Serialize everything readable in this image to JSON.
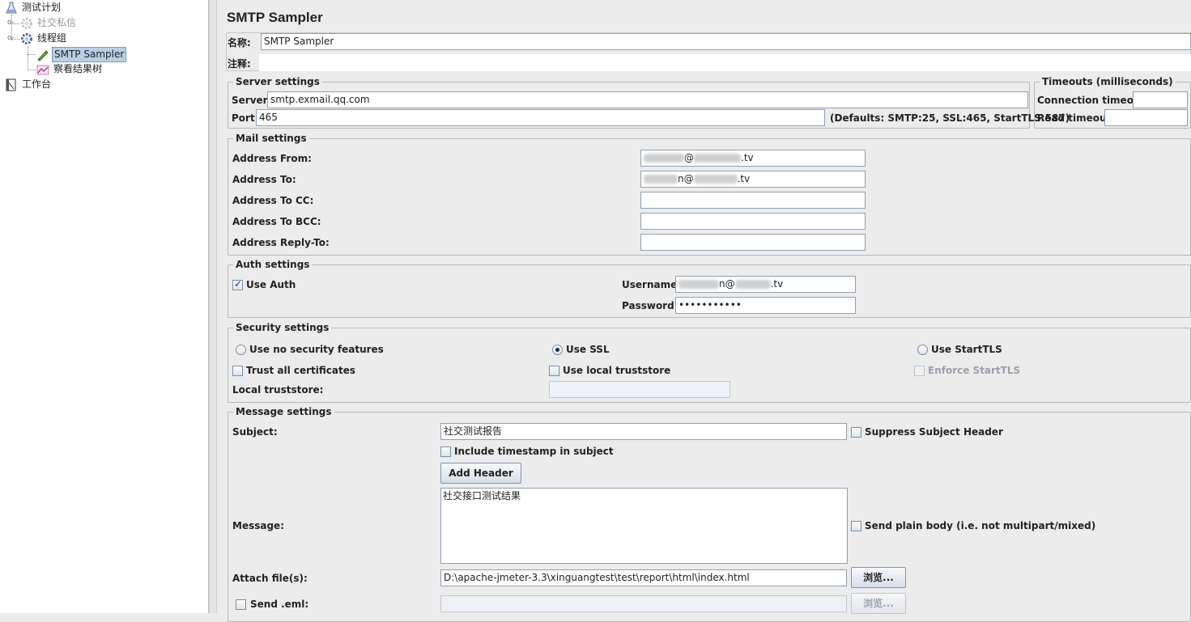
{
  "tree": {
    "items": [
      {
        "label": "测试计划",
        "icon": "test-plan-icon"
      },
      {
        "label": "社交私信",
        "icon": "thread-group-gear-icon",
        "disabled": true
      },
      {
        "label": "线程组",
        "icon": "thread-group-gear-icon"
      },
      {
        "label": "SMTP Sampler",
        "icon": "sampler-pen-icon",
        "selected": true
      },
      {
        "label": "察看结果树",
        "icon": "result-tree-icon"
      },
      {
        "label": "工作台",
        "icon": "workbench-icon"
      }
    ]
  },
  "panel": {
    "title": "SMTP Sampler",
    "name_label": "名称:",
    "name_value": "SMTP Sampler",
    "comment_label": "注释:",
    "comment_value": ""
  },
  "server": {
    "title": "Server settings",
    "server_label": "Server:",
    "server_value": "smtp.exmail.qq.com",
    "port_label": "Port:",
    "port_value": "465",
    "defaults_text": "(Defaults: SMTP:25, SSL:465, StartTLS:587)"
  },
  "timeouts": {
    "title": "Timeouts (milliseconds)",
    "connection_label": "Connection timeout:",
    "connection_value": "",
    "read_label": "Read timeout:",
    "read_value": ""
  },
  "mail": {
    "title": "Mail settings",
    "from_label": "Address From:",
    "from_suffix": "@",
    "from_domain": ".tv",
    "to_label": "Address To:",
    "to_suffix": "n@",
    "to_domain": ".tv",
    "cc_label": "Address To CC:",
    "cc_value": "",
    "bcc_label": "Address To BCC:",
    "bcc_value": "",
    "reply_label": "Address Reply-To:",
    "reply_value": ""
  },
  "auth": {
    "title": "Auth settings",
    "use_auth_label": "Use Auth",
    "use_auth_checked": true,
    "username_label": "Username:",
    "username_mid": "n@",
    "username_domain": ".tv",
    "password_label": "Password:",
    "password_value": "•••••••••••"
  },
  "security": {
    "title": "Security settings",
    "no_security_label": "Use no security features",
    "ssl_label": "Use SSL",
    "starttls_label": "Use StartTLS",
    "selected": "Use SSL",
    "trust_all_label": "Trust all certificates",
    "local_truststore_cb_label": "Use local truststore",
    "enforce_label": "Enforce StartTLS",
    "local_truststore_label": "Local truststore:",
    "local_truststore_value": ""
  },
  "message": {
    "title": "Message settings",
    "subject_label": "Subject:",
    "subject_value": "社交测试报告",
    "suppress_label": "Suppress Subject Header",
    "timestamp_label": "Include timestamp in subject",
    "add_header_label": "Add Header",
    "message_label": "Message:",
    "message_value": "社交接口测试结果",
    "plain_body_label": "Send plain body (i.e. not multipart/mixed)",
    "attach_label": "Attach file(s):",
    "attach_value": "D:\\apache-jmeter-3.3\\xinguangtest\\test\\report\\html\\index.html",
    "browse_label": "浏览...",
    "send_eml_label": "Send .eml:",
    "send_eml_value": "",
    "browse2_label": "浏览..."
  }
}
